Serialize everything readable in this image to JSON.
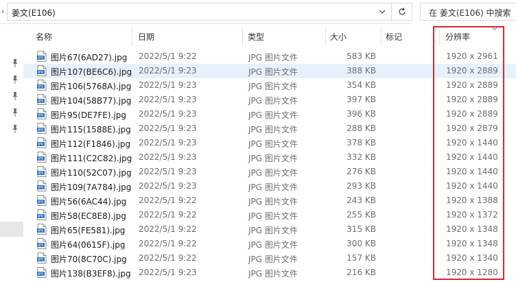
{
  "address": {
    "path": "姜文(E106)",
    "search_placeholder": "在 姜文(E106) 中搜索"
  },
  "columns": {
    "name": "名称",
    "date": "日期",
    "type": "类型",
    "size": "大小",
    "tags": "标记",
    "resolution": "分辨率"
  },
  "selected_row_index": 1,
  "highlight_color": "#d8262f",
  "files": [
    {
      "name": "图片67(6AD27).jpg",
      "date": "2022/5/1 9:22",
      "type": "JPG 图片文件",
      "size": "583 KB",
      "resolution": "1920 x 2961"
    },
    {
      "name": "图片107(BE6C6).jpg",
      "date": "2022/5/1 9:23",
      "type": "JPG 图片文件",
      "size": "388 KB",
      "resolution": "1920 x 2889"
    },
    {
      "name": "图片106(5768A).jpg",
      "date": "2022/5/1 9:23",
      "type": "JPG 图片文件",
      "size": "354 KB",
      "resolution": "1920 x 2889"
    },
    {
      "name": "图片104(58B77).jpg",
      "date": "2022/5/1 9:23",
      "type": "JPG 图片文件",
      "size": "397 KB",
      "resolution": "1920 x 2889"
    },
    {
      "name": "图片95(DE7FE).jpg",
      "date": "2022/5/1 9:23",
      "type": "JPG 图片文件",
      "size": "396 KB",
      "resolution": "1920 x 2889"
    },
    {
      "name": "图片115(1588E).jpg",
      "date": "2022/5/1 9:23",
      "type": "JPG 图片文件",
      "size": "288 KB",
      "resolution": "1920 x 2879"
    },
    {
      "name": "图片112(F1846).jpg",
      "date": "2022/5/1 9:23",
      "type": "JPG 图片文件",
      "size": "378 KB",
      "resolution": "1920 x 1440"
    },
    {
      "name": "图片111(C2C82).jpg",
      "date": "2022/5/1 9:23",
      "type": "JPG 图片文件",
      "size": "332 KB",
      "resolution": "1920 x 1440"
    },
    {
      "name": "图片110(52C07).jpg",
      "date": "2022/5/1 9:23",
      "type": "JPG 图片文件",
      "size": "276 KB",
      "resolution": "1920 x 1440"
    },
    {
      "name": "图片109(7A784).jpg",
      "date": "2022/5/1 9:23",
      "type": "JPG 图片文件",
      "size": "293 KB",
      "resolution": "1920 x 1440"
    },
    {
      "name": "图片56(6AC44).jpg",
      "date": "2022/5/1 9:22",
      "type": "JPG 图片文件",
      "size": "243 KB",
      "resolution": "1920 x 1388"
    },
    {
      "name": "图片58(EC8E8).jpg",
      "date": "2022/5/1 9:22",
      "type": "JPG 图片文件",
      "size": "255 KB",
      "resolution": "1920 x 1372"
    },
    {
      "name": "图片65(FE581).jpg",
      "date": "2022/5/1 9:22",
      "type": "JPG 图片文件",
      "size": "315 KB",
      "resolution": "1920 x 1348"
    },
    {
      "name": "图片64(0615F).jpg",
      "date": "2022/5/1 9:22",
      "type": "JPG 图片文件",
      "size": "300 KB",
      "resolution": "1920 x 1348"
    },
    {
      "name": "图片70(8C70C).jpg",
      "date": "2022/5/1 9:22",
      "type": "JPG 图片文件",
      "size": "157 KB",
      "resolution": "1920 x 1340"
    },
    {
      "name": "图片138(B3EF8).jpg",
      "date": "2022/5/1 9:23",
      "type": "JPG 图片文件",
      "size": "216 KB",
      "resolution": "1920 x 1280"
    }
  ]
}
